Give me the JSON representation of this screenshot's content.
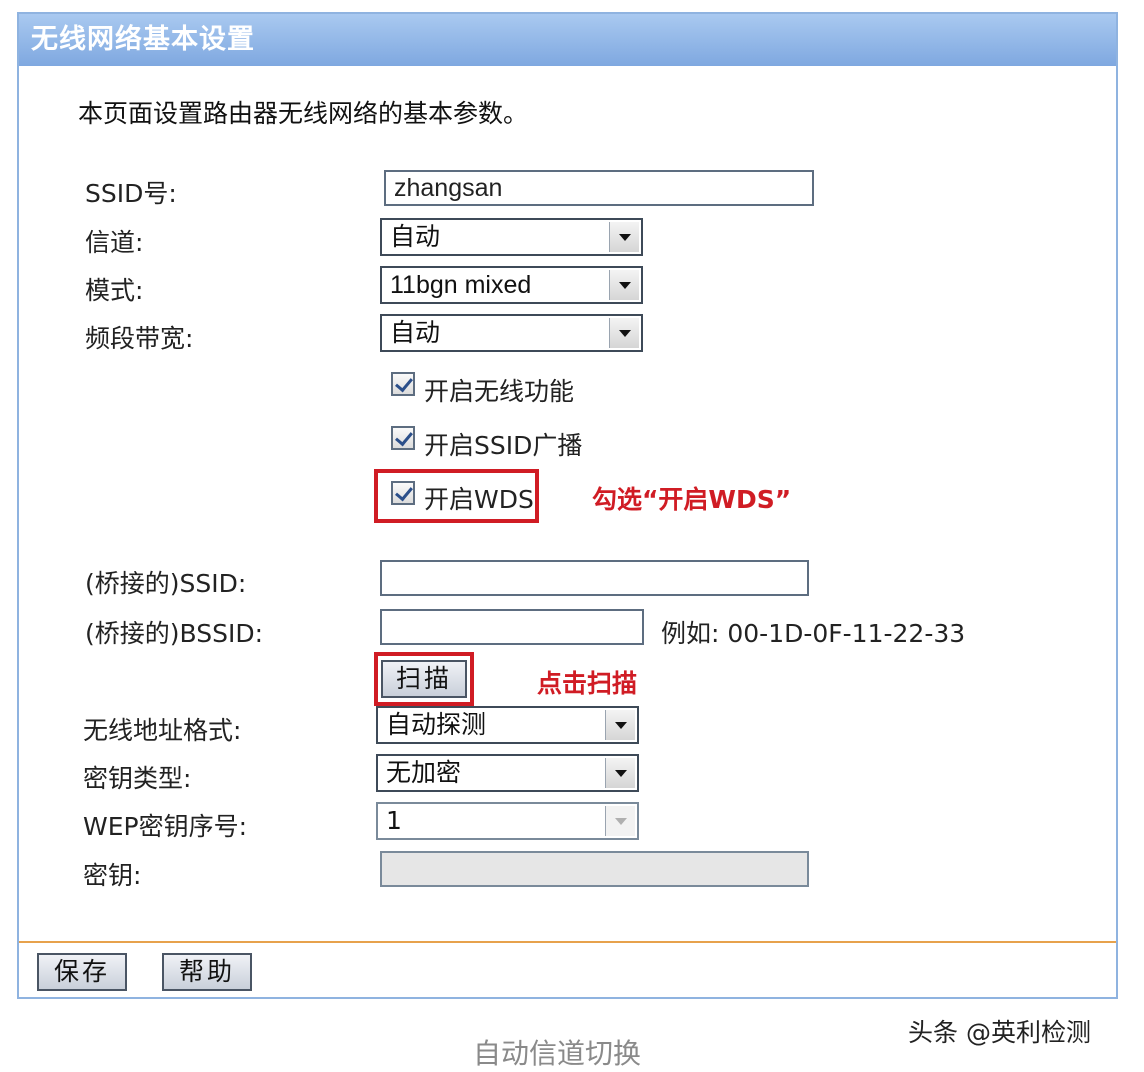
{
  "title": "无线网络基本设置",
  "intro": "本页面设置路由器无线网络的基本参数。",
  "fields": {
    "ssid_label": "SSID号:",
    "ssid_value": "zhangsan",
    "channel_label": "信道:",
    "channel_value": "自动",
    "mode_label": "模式:",
    "mode_value": "11bgn mixed",
    "bandwidth_label": "频段带宽:",
    "bandwidth_value": "自动"
  },
  "checkboxes": {
    "wireless": "开启无线功能",
    "ssid_broadcast": "开启SSID广播",
    "wds": "开启WDS"
  },
  "annotations": {
    "wds": "勾选“开启WDS”",
    "scan": "点击扫描"
  },
  "bridge": {
    "ssid_label": "(桥接的)SSID:",
    "ssid_value": "",
    "bssid_label": "(桥接的)BSSID:",
    "bssid_value": "",
    "bssid_example": "例如: 00-1D-0F-11-22-33",
    "scan_button": "扫描"
  },
  "security": {
    "addr_format_label": "无线地址格式:",
    "addr_format_value": "自动探测",
    "key_type_label": "密钥类型:",
    "key_type_value": "无加密",
    "wep_index_label": "WEP密钥序号:",
    "wep_index_value": "1",
    "key_label": "密钥:",
    "key_value": ""
  },
  "footer": {
    "save_button": "保存",
    "help_button": "帮助"
  },
  "caption": "自动信道切换",
  "watermark": "头条 @英利检测",
  "colors": {
    "titlebar": "#7fa8e0",
    "highlight": "#d01c24",
    "footer_line": "#e7a24c"
  }
}
